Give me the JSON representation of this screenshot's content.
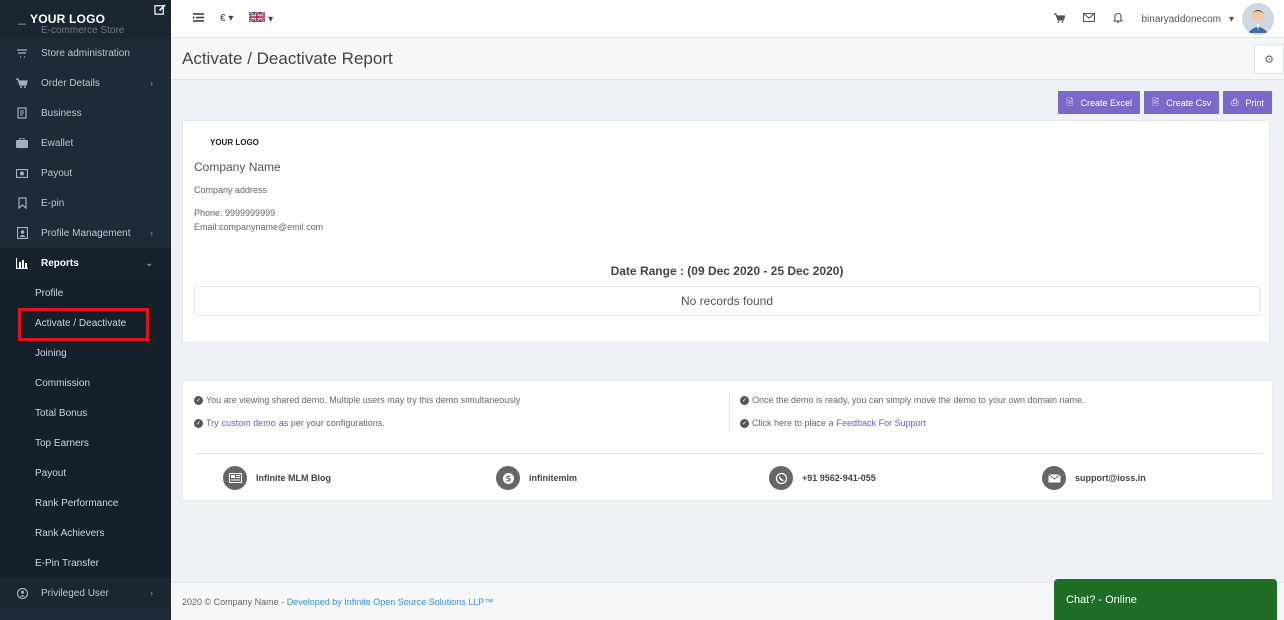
{
  "sidebar": {
    "brand": "YOUR LOGO",
    "partial_item": "E-commerce Store",
    "items": [
      {
        "label": "Store administration",
        "icon": "cart-arrow-icon",
        "chevron": false
      },
      {
        "label": "Order Details",
        "icon": "cart-icon",
        "chevron": true
      },
      {
        "label": "Business",
        "icon": "document-icon",
        "chevron": false
      },
      {
        "label": "Ewallet",
        "icon": "briefcase-icon",
        "chevron": false
      },
      {
        "label": "Payout",
        "icon": "money-icon",
        "chevron": false
      },
      {
        "label": "E-pin",
        "icon": "bookmark-icon",
        "chevron": false
      },
      {
        "label": "Profile Management",
        "icon": "profile-card-icon",
        "chevron": true
      }
    ],
    "reports": {
      "label": "Reports",
      "icon": "bar-chart-icon"
    },
    "report_items": [
      "Profile",
      "Activate / Deactivate",
      "Joining",
      "Commission",
      "Total Bonus",
      "Top Earners",
      "Payout",
      "Rank Performance",
      "Rank Achievers",
      "E-Pin Transfer"
    ],
    "privileged": {
      "label": "Privileged User",
      "icon": "user-icon"
    }
  },
  "topbar": {
    "currency": "€",
    "username": "binaryaddonecom"
  },
  "page": {
    "title": "Activate / Deactivate Report"
  },
  "actions": {
    "excel": "Create Excel",
    "csv": "Create Csv",
    "print": "Print"
  },
  "report": {
    "logo": "YOUR LOGO",
    "company_name": "Company Name",
    "company_address": "Company address",
    "phone": "Phone: 9999999999",
    "email": "Email:companyname@emil.com",
    "date_range": "Date Range : (09 Dec 2020 - 25 Dec 2020)",
    "empty": "No records found"
  },
  "info": {
    "line1": "You are viewing shared demo. Multiple users may try this demo simultaneously",
    "line2_pre": "Try ",
    "line2_link": "custom demo",
    "line2_post": " as per your configurations.",
    "line3": "Once the demo is ready, you can simply move the demo to your own domain name.",
    "line4_pre": "Click here to place a ",
    "line4_link": "Feedback For Support",
    "contacts": {
      "blog": "Infinite MLM Blog",
      "skype": "infinitemlm",
      "phone": "+91 9562-941-055",
      "email": "support@ioss.in"
    }
  },
  "footer": {
    "text": "2020 © Company Name - ",
    "link": "Developed by Infinite Open Source Solutions LLP™"
  },
  "chat": {
    "label": "Chat? - Online"
  },
  "colors": {
    "sidebar_bg": "#1e2a36",
    "accent_button": "#7b68c8",
    "active_highlight": "#e3121b",
    "chat_bg": "#1f6e25"
  }
}
